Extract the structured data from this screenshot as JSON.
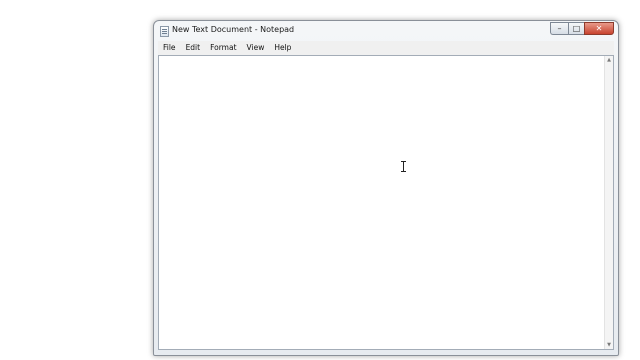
{
  "window": {
    "title": "New Text Document - Notepad",
    "icon": "notepad-icon"
  },
  "caption_buttons": {
    "minimize_icon": "minimize-icon",
    "maximize_icon": "maximize-icon",
    "close_icon": "close-icon",
    "close_color": "#c8432f"
  },
  "menu": {
    "items": [
      {
        "label": "File"
      },
      {
        "label": "Edit"
      },
      {
        "label": "Format"
      },
      {
        "label": "View"
      },
      {
        "label": "Help"
      }
    ]
  },
  "editor": {
    "content": ""
  },
  "pointer": {
    "icon": "ibeam-cursor-icon"
  }
}
